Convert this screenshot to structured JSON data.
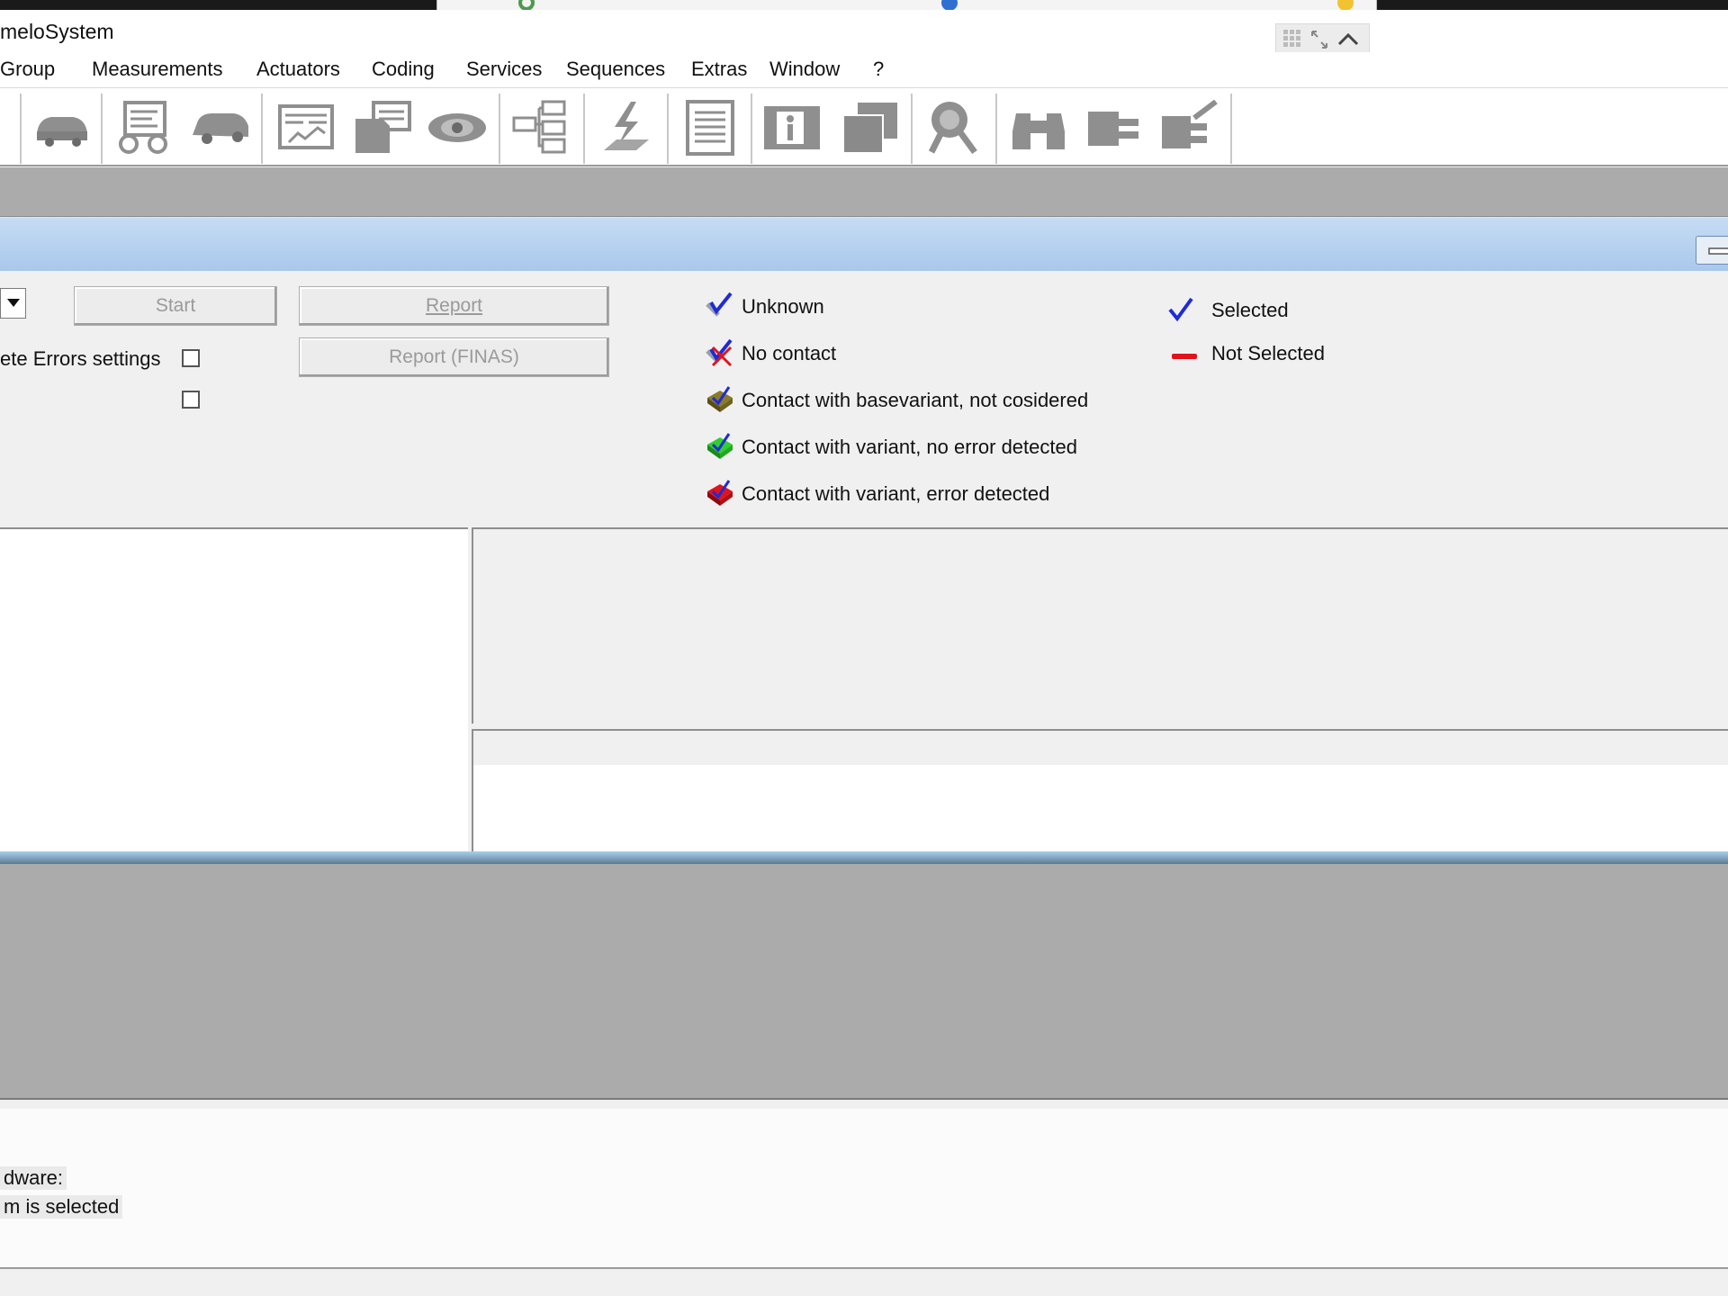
{
  "window": {
    "title": "meloSystem"
  },
  "menu": [
    "Group",
    "Measurements",
    "Actuators",
    "Coding",
    "Services",
    "Sequences",
    "Extras",
    "Window",
    "?"
  ],
  "toolbar_icons": [
    "vehicle-icon",
    "ecu-diagram-icon",
    "car-icon",
    "screen-chart-icon",
    "document-stack-icon",
    "eye-icon",
    "network-icon",
    "flash-icon",
    "list-icon",
    "info-icon",
    "copy-icon",
    "magnifier-icon",
    "binoculars-icon",
    "plug-icon",
    "plug-edit-icon"
  ],
  "controls": {
    "start_label": "Start",
    "report_label": "Report",
    "report_finas_label": "Report (FINAS)",
    "errors_settings_label": "ete Errors settings"
  },
  "legend": {
    "unknown": "Unknown",
    "no_contact": "No contact",
    "contact_base": "Contact with basevariant, not cosidered",
    "contact_ok": "Contact with variant, no error detected",
    "contact_err": "Contact with variant, error detected",
    "selected": "Selected",
    "not_selected": "Not Selected"
  },
  "status": {
    "hardware_label": "dware:",
    "selection_text": "m is selected"
  },
  "colors": {
    "blue_check": "#1f2bd6",
    "red_dash": "#e0131c",
    "caption_blue": "#b9d3f0"
  }
}
